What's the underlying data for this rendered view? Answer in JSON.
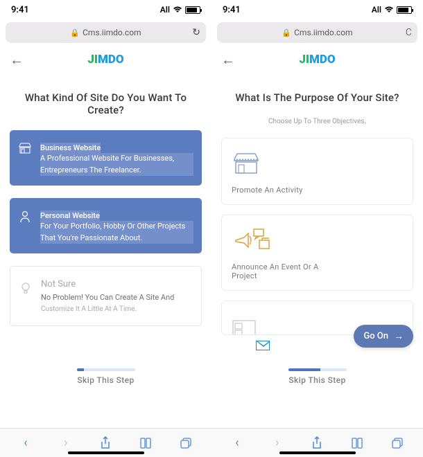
{
  "status": {
    "time": "9:41",
    "carrier": "All"
  },
  "url": "Cms.iimdo.com",
  "logo_text": "JIMDO",
  "left": {
    "heading": "What Kind Of Site Do You Want To Create?",
    "cards": [
      {
        "title": "Business Website",
        "desc": "A Professional Website For Businesses, Entrepreneurs The Freelancer."
      },
      {
        "title": "Personal Website",
        "desc": "For Your Portfolio, Hobby Or Other Projects That You're Passionate About."
      },
      {
        "title": "Not Sure",
        "desc": "No Problem! You Can Create A Site And",
        "desc2": "Customize It A Little At A Time."
      }
    ],
    "skip": "Skip This Step",
    "progress_pct": 12
  },
  "right": {
    "heading": "What Is The Purpose Of Your Site?",
    "sub": "Choose Up To Three Objectives.",
    "tiles": [
      {
        "label": "Promote An Activity"
      },
      {
        "label": "Announce An Event Or A Project"
      }
    ],
    "go_on": "Go On",
    "skip": "Skip This Step",
    "progress_pct": 55
  }
}
